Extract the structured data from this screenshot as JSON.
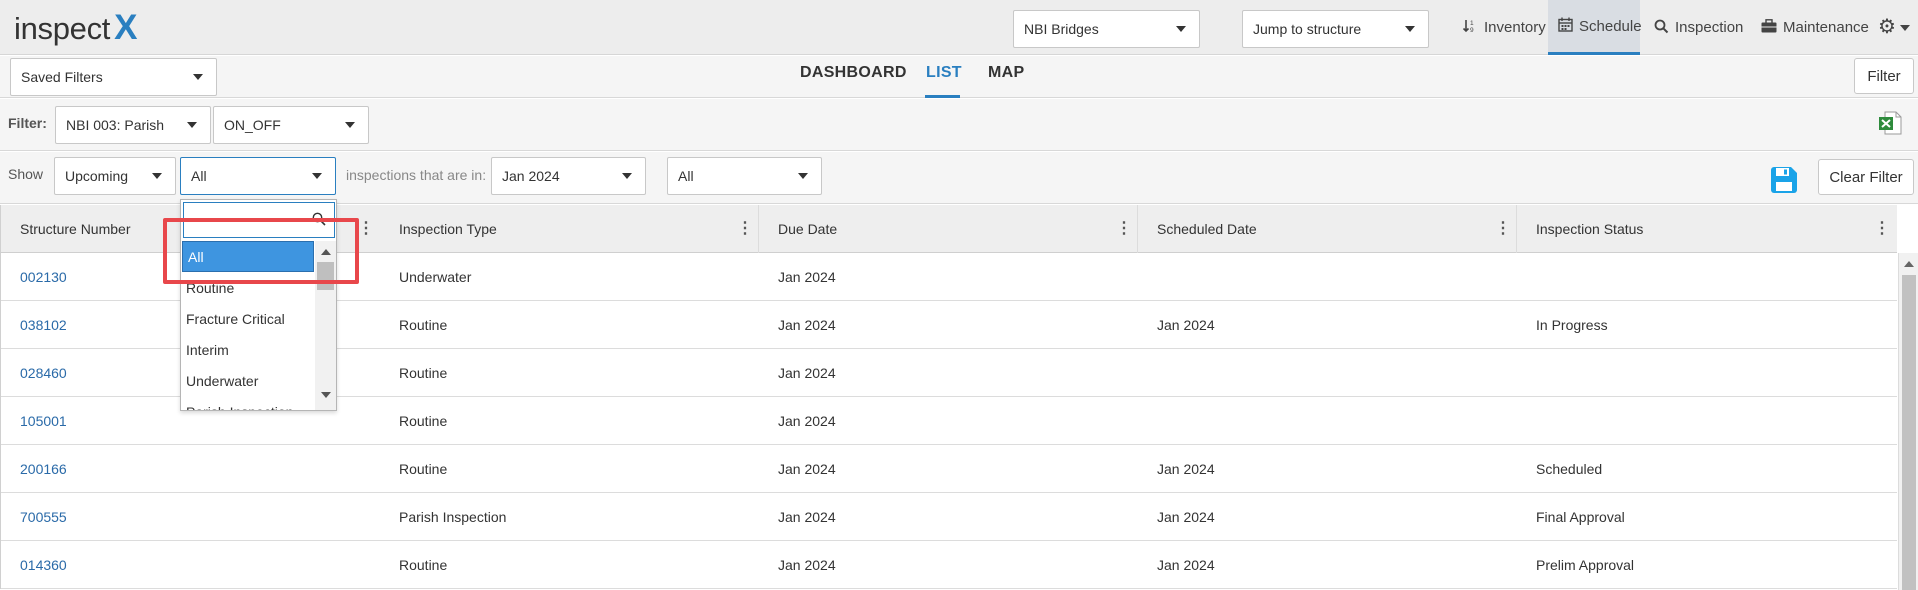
{
  "header": {
    "logo_text": "inspect",
    "logo_mark": "X",
    "asset_select": "NBI Bridges",
    "jump_select": "Jump to structure",
    "nav": [
      {
        "label": "Inventory",
        "icon": "sort-icon"
      },
      {
        "label": "Schedule",
        "icon": "calendar-icon",
        "active": true
      },
      {
        "label": "Inspection",
        "icon": "search-icon"
      },
      {
        "label": "Maintenance",
        "icon": "toolbox-icon"
      }
    ],
    "settings_icon": "gear-icon"
  },
  "view_bar": {
    "saved_filters": "Saved Filters",
    "tabs": [
      "DASHBOARD",
      "LIST",
      "MAP"
    ],
    "active_tab": "LIST",
    "filter_button": "Filter"
  },
  "filter_bar": {
    "label": "Filter:",
    "field1": "NBI 003: Parish",
    "field2": "ON_OFF"
  },
  "show_bar": {
    "label": "Show",
    "timing": "Upcoming",
    "type": "All",
    "middle_text": "inspections that are in:",
    "period": "Jan 2024",
    "status": "All",
    "clear_button": "Clear Filter"
  },
  "dropdown": {
    "search_value": "",
    "options": [
      "All",
      "Routine",
      "Fracture Critical",
      "Interim",
      "Underwater",
      "Parish Inspection"
    ],
    "selected": "All"
  },
  "table": {
    "columns": [
      "Structure Number",
      "Inspection Type",
      "Due Date",
      "Scheduled Date",
      "Inspection Status"
    ],
    "rows": [
      {
        "structure": "002130",
        "type": "Underwater",
        "due": "Jan 2024",
        "scheduled": "",
        "status": ""
      },
      {
        "structure": "038102",
        "type": "Routine",
        "due": "Jan 2024",
        "scheduled": "Jan 2024",
        "status": "In Progress"
      },
      {
        "structure": "028460",
        "type": "Routine",
        "due": "Jan 2024",
        "scheduled": "",
        "status": ""
      },
      {
        "structure": "105001",
        "type": "Routine",
        "due": "Jan 2024",
        "scheduled": "",
        "status": ""
      },
      {
        "structure": "200166",
        "type": "Routine",
        "due": "Jan 2024",
        "scheduled": "Jan 2024",
        "status": "Scheduled"
      },
      {
        "structure": "700555",
        "type": "Parish Inspection",
        "due": "Jan 2024",
        "scheduled": "Jan 2024",
        "status": "Final Approval"
      },
      {
        "structure": "014360",
        "type": "Routine",
        "due": "Jan 2024",
        "scheduled": "Jan 2024",
        "status": "Prelim Approval"
      }
    ]
  },
  "colors": {
    "accent": "#2a7fc0",
    "link": "#2a6aa8",
    "highlight": "#e8474b",
    "selected_option": "#3e95e0"
  }
}
